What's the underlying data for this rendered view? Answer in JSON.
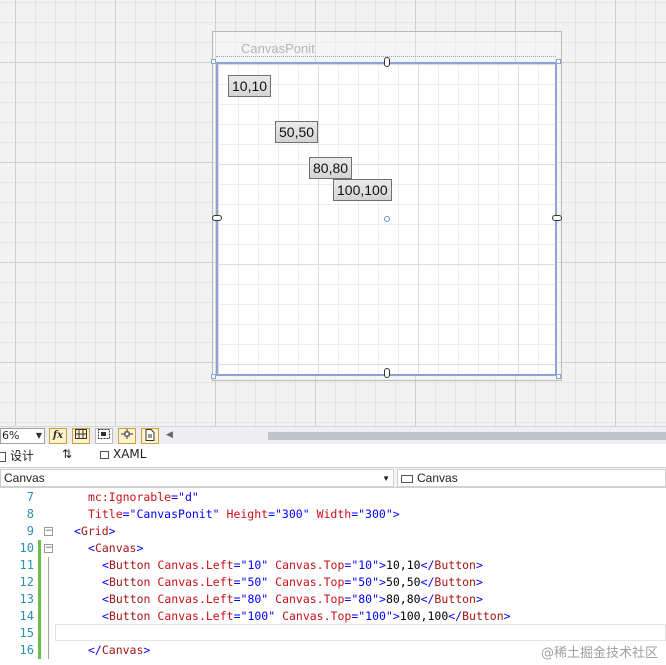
{
  "designer": {
    "window_title": "CanvasPonit",
    "buttons": [
      {
        "label": "10,10"
      },
      {
        "label": "50,50"
      },
      {
        "label": "80,80"
      },
      {
        "label": "100,100"
      }
    ]
  },
  "toolbar": {
    "zoom": "6%",
    "fx_label": "fx"
  },
  "tabs": {
    "design": "设计",
    "swap": "⇅",
    "xaml": "XAML"
  },
  "nav": {
    "element": "Canvas",
    "member": "Canvas"
  },
  "editor": {
    "line_numbers": [
      "7",
      "8",
      "9",
      "10",
      "11",
      "12",
      "13",
      "14",
      "15",
      "16"
    ],
    "lines": [
      {
        "tokens": [
          [
            "t-red",
            "mc:Ignorable"
          ],
          [
            "t-blue",
            "=\""
          ],
          [
            "t-blue",
            "d"
          ],
          [
            "t-blue",
            "\""
          ]
        ]
      },
      {
        "tokens": [
          [
            "t-red",
            "Title"
          ],
          [
            "t-blue",
            "=\""
          ],
          [
            "t-blue",
            "CanvasPonit"
          ],
          [
            "t-blue",
            "\" "
          ],
          [
            "t-red",
            "Height"
          ],
          [
            "t-blue",
            "=\""
          ],
          [
            "t-blue",
            "300"
          ],
          [
            "t-blue",
            "\" "
          ],
          [
            "t-red",
            "Width"
          ],
          [
            "t-blue",
            "=\""
          ],
          [
            "t-blue",
            "300"
          ],
          [
            "t-blue",
            "\">"
          ]
        ]
      },
      {
        "tokens": [
          [
            "t-blue",
            "<"
          ],
          [
            "t-brown",
            "Grid"
          ],
          [
            "t-blue",
            ">"
          ]
        ]
      },
      {
        "tokens": [
          [
            "t-blue",
            "<"
          ],
          [
            "t-brown",
            "Canvas"
          ],
          [
            "t-blue",
            ">"
          ]
        ]
      },
      {
        "tokens": [
          [
            "t-blue",
            "<"
          ],
          [
            "t-brown",
            "Button"
          ],
          [
            "t-plain",
            " "
          ],
          [
            "t-red",
            "Canvas.Left"
          ],
          [
            "t-blue",
            "=\"10\" "
          ],
          [
            "t-red",
            "Canvas.Top"
          ],
          [
            "t-blue",
            "=\"10\">"
          ],
          [
            "t-plain",
            "10,10"
          ],
          [
            "t-blue",
            "</"
          ],
          [
            "t-brown",
            "Button"
          ],
          [
            "t-blue",
            ">"
          ]
        ]
      },
      {
        "tokens": [
          [
            "t-blue",
            "<"
          ],
          [
            "t-brown",
            "Button"
          ],
          [
            "t-plain",
            " "
          ],
          [
            "t-red",
            "Canvas.Left"
          ],
          [
            "t-blue",
            "=\"50\" "
          ],
          [
            "t-red",
            "Canvas.Top"
          ],
          [
            "t-blue",
            "=\"50\">"
          ],
          [
            "t-plain",
            "50,50"
          ],
          [
            "t-blue",
            "</"
          ],
          [
            "t-brown",
            "Button"
          ],
          [
            "t-blue",
            ">"
          ]
        ]
      },
      {
        "tokens": [
          [
            "t-blue",
            "<"
          ],
          [
            "t-brown",
            "Button"
          ],
          [
            "t-plain",
            " "
          ],
          [
            "t-red",
            "Canvas.Left"
          ],
          [
            "t-blue",
            "=\"80\" "
          ],
          [
            "t-red",
            "Canvas.Top"
          ],
          [
            "t-blue",
            "=\"80\">"
          ],
          [
            "t-plain",
            "80,80"
          ],
          [
            "t-blue",
            "</"
          ],
          [
            "t-brown",
            "Button"
          ],
          [
            "t-blue",
            ">"
          ]
        ]
      },
      {
        "tokens": [
          [
            "t-blue",
            "<"
          ],
          [
            "t-brown",
            "Button"
          ],
          [
            "t-plain",
            " "
          ],
          [
            "t-red",
            "Canvas.Left"
          ],
          [
            "t-blue",
            "=\"100\" "
          ],
          [
            "t-red",
            "Canvas.Top"
          ],
          [
            "t-blue",
            "=\"100\">"
          ],
          [
            "t-plain",
            "100,100"
          ],
          [
            "t-blue",
            "</"
          ],
          [
            "t-brown",
            "Button"
          ],
          [
            "t-blue",
            ">"
          ]
        ]
      },
      {
        "tokens": []
      },
      {
        "tokens": [
          [
            "t-blue",
            "</"
          ],
          [
            "t-brown",
            "Canvas"
          ],
          [
            "t-blue",
            ">"
          ]
        ]
      }
    ]
  },
  "watermark": "@稀土掘金技术社区"
}
